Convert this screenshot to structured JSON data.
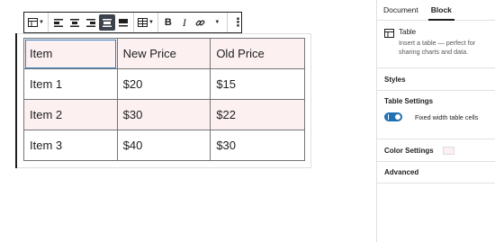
{
  "toolbar": {
    "items": [
      "table-icon",
      "align-left-icon",
      "align-center-icon",
      "align-right-icon",
      "align-wide-icon",
      "align-full-icon",
      "table-edit-icon",
      "bold-icon",
      "italic-icon",
      "link-icon",
      "more-options-icon"
    ],
    "bold_label": "B",
    "italic_label": "I",
    "more_label": "⋮"
  },
  "table": {
    "rows": [
      [
        "Item",
        "New Price",
        "Old Price"
      ],
      [
        "Item 1",
        "$20",
        "$15"
      ],
      [
        "Item 2",
        "$30",
        "$22"
      ],
      [
        "Item 3",
        "$40",
        "$30"
      ]
    ],
    "stripe_color": "#fcf0f1"
  },
  "sidebar": {
    "tabs": [
      "Document",
      "Block"
    ],
    "active_tab": "Block",
    "block": {
      "title": "Table",
      "description": "Insert a table — perfect for sharing charts and data.",
      "icon": "table-icon"
    },
    "panels": {
      "styles": "Styles",
      "table_settings": "Table Settings",
      "toggle_label": "Fixed width table cells",
      "toggle_on": true,
      "color_settings": "Color Settings",
      "color_value": "#fcf0f1",
      "advanced": "Advanced"
    },
    "accent_color": "#2271b1"
  }
}
